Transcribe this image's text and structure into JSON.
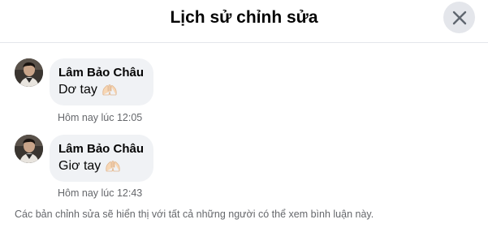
{
  "dialog": {
    "title": "Lịch sử chỉnh sửa",
    "close_icon": "close-icon"
  },
  "history": [
    {
      "author": "Lâm Bảo Châu",
      "text": "Dơ tay",
      "emoji_icon": "raised-hands-emoji-icon",
      "timestamp": "Hôm nay lúc 12:05"
    },
    {
      "author": "Lâm Bảo Châu",
      "text": "Giơ tay",
      "emoji_icon": "raised-hands-emoji-icon",
      "timestamp": "Hôm nay lúc 12:43"
    }
  ],
  "footer": {
    "note": "Các bản chỉnh sửa sẽ hiển thị với tất cả những người có thể xem bình luận này."
  },
  "colors": {
    "bubble_bg": "#f0f2f5",
    "close_bg": "#e4e6eb",
    "secondary_text": "#65676b",
    "primary_text": "#050505"
  }
}
